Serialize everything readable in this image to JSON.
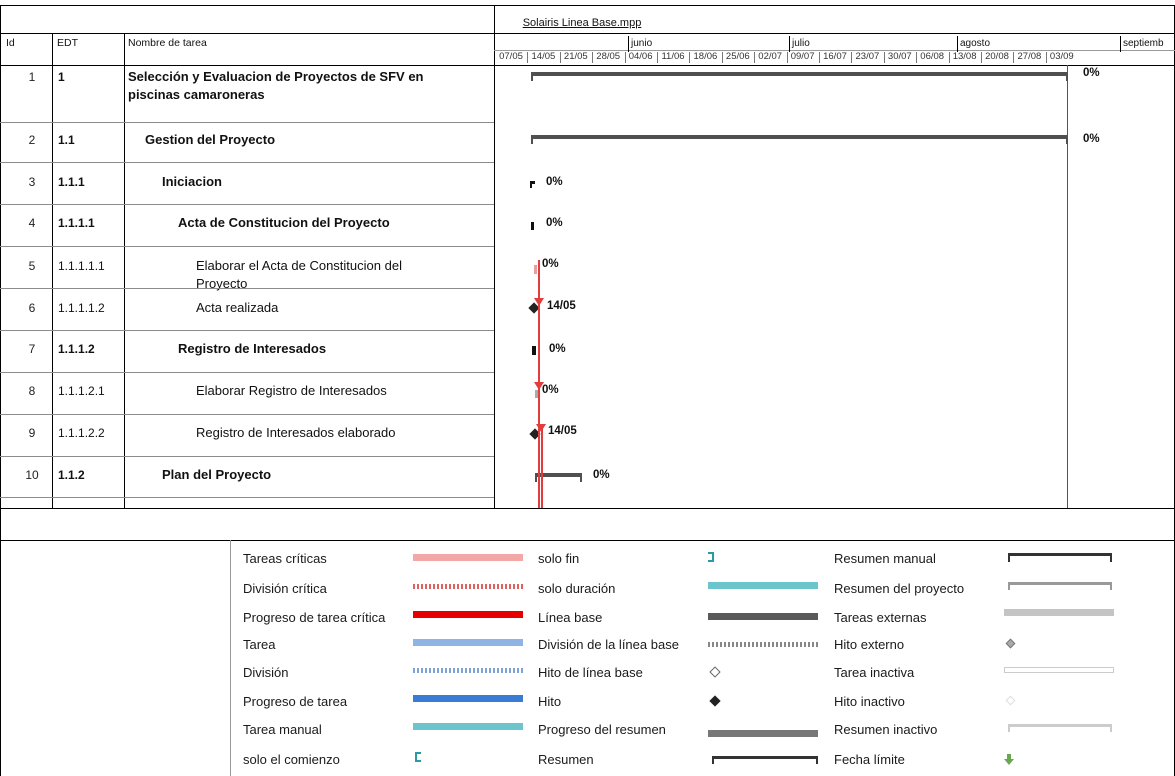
{
  "title": "Solairis Linea Base.mpp",
  "columns": {
    "id": "Id",
    "edt": "EDT",
    "name": "Nombre de tarea"
  },
  "timescale": {
    "months": [
      "junio",
      "julio",
      "agosto",
      "septiemb"
    ],
    "weeks": [
      "07/05",
      "14/05",
      "21/05",
      "28/05",
      "04/06",
      "11/06",
      "18/06",
      "25/06",
      "02/07",
      "09/07",
      "16/07",
      "23/07",
      "30/07",
      "06/08",
      "13/08",
      "20/08",
      "27/08",
      "03/09"
    ]
  },
  "tasks": [
    {
      "id": "1",
      "edt": "1",
      "name": "Selección y Evaluacion de Proyectos de SFV en piscinas camaroneras",
      "pct": "0%"
    },
    {
      "id": "2",
      "edt": "1.1",
      "name": "Gestion del Proyecto",
      "pct": "0%"
    },
    {
      "id": "3",
      "edt": "1.1.1",
      "name": "Iniciacion",
      "pct": "0%"
    },
    {
      "id": "4",
      "edt": "1.1.1.1",
      "name": "Acta de Constitucion del Proyecto",
      "pct": "0%"
    },
    {
      "id": "5",
      "edt": "1.1.1.1.1",
      "name": "Elaborar el Acta de Constitucion del Proyecto",
      "pct": "0%"
    },
    {
      "id": "6",
      "edt": "1.1.1.1.2",
      "name": "Acta realizada",
      "pct": "14/05"
    },
    {
      "id": "7",
      "edt": "1.1.1.2",
      "name": "Registro de Interesados",
      "pct": "0%"
    },
    {
      "id": "8",
      "edt": "1.1.1.2.1",
      "name": "Elaborar Registro de Interesados",
      "pct": "0%"
    },
    {
      "id": "9",
      "edt": "1.1.1.2.2",
      "name": "Registro de Interesados elaborado",
      "pct": "14/05"
    },
    {
      "id": "10",
      "edt": "1.1.2",
      "name": "Plan del Proyecto",
      "pct": "0%"
    }
  ],
  "legend": {
    "col1": [
      "Tareas críticas",
      "División crítica",
      "Progreso de tarea crítica",
      "Tarea",
      "División",
      "Progreso de tarea",
      "Tarea manual",
      "solo el comienzo"
    ],
    "col2": [
      "solo fin",
      "solo duración",
      "Línea base",
      "División de la línea base",
      "Hito de línea base",
      "Hito",
      "Progreso del resumen",
      "Resumen"
    ],
    "col3": [
      "Resumen manual",
      "Resumen del proyecto",
      "Tareas externas",
      "Hito externo",
      "Tarea inactiva",
      "Hito inactivo",
      "Resumen inactivo",
      "Fecha límite"
    ]
  },
  "colors": {
    "critical_task": "#f4a7a7",
    "critical_progress": "#e60000",
    "task": "#8fb4e3",
    "task_progress": "#3a7bd5",
    "manual_task": "#6cc4cc",
    "summary": "#505050",
    "deadline_arrow": "#6aa84f"
  }
}
